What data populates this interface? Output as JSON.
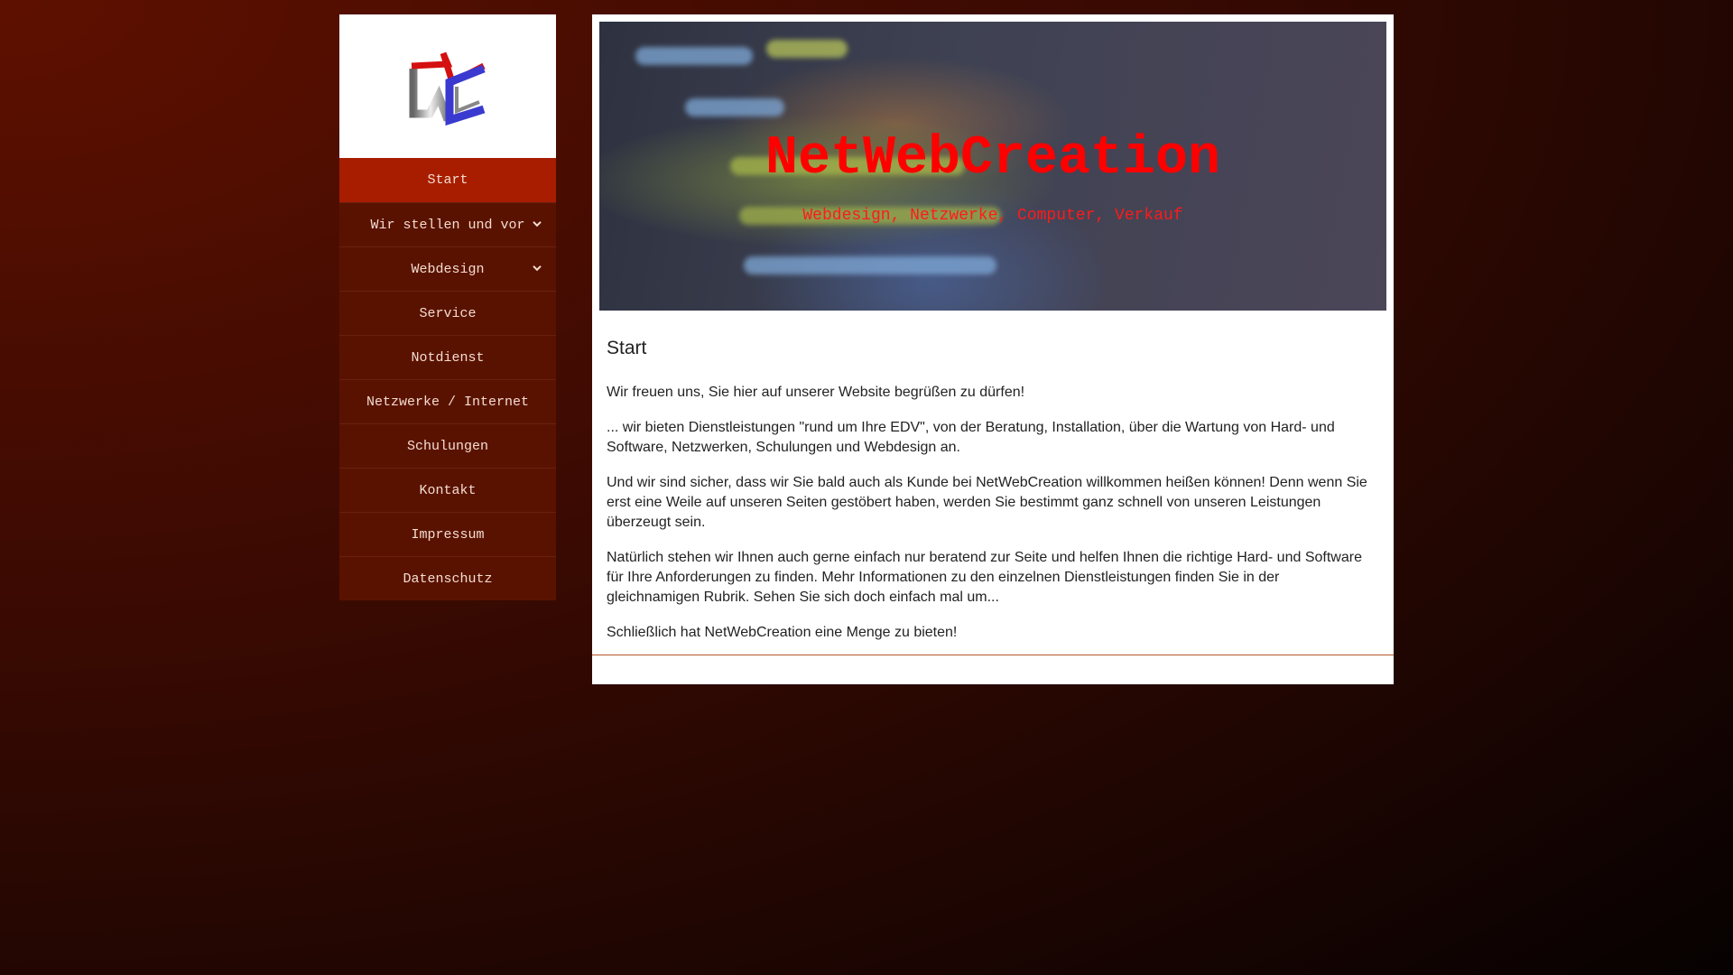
{
  "logo": {
    "alt": "NWC"
  },
  "nav": {
    "items": [
      {
        "label": "Start",
        "active": true,
        "has_submenu": false
      },
      {
        "label": "Wir stellen und vor",
        "active": false,
        "has_submenu": true
      },
      {
        "label": "Webdesign",
        "active": false,
        "has_submenu": true
      },
      {
        "label": "Service",
        "active": false,
        "has_submenu": false
      },
      {
        "label": "Notdienst",
        "active": false,
        "has_submenu": false
      },
      {
        "label": "Netzwerke / Internet",
        "active": false,
        "has_submenu": false
      },
      {
        "label": "Schulungen",
        "active": false,
        "has_submenu": false
      },
      {
        "label": "Kontakt",
        "active": false,
        "has_submenu": false
      },
      {
        "label": "Impressum",
        "active": false,
        "has_submenu": false
      },
      {
        "label": "Datenschutz",
        "active": false,
        "has_submenu": false
      }
    ]
  },
  "banner": {
    "title": "NetWebCreation",
    "subtitle": "Webdesign, Netzwerke, Computer, Verkauf"
  },
  "main": {
    "heading": "Start",
    "paragraphs": [
      "Wir freuen uns, Sie hier auf unserer Website begrüßen zu dürfen!",
      "... wir bieten Dienstleistungen \"rund um Ihre EDV\", von der Beratung, Installation, über die Wartung von Hard- und Software, Netzwerken, Schulungen und Webdesign an.",
      "Und wir sind sicher, dass wir Sie bald auch als Kunde bei NetWebCreation willkommen heißen können! Denn wenn Sie erst eine Weile auf unseren Seiten gestöbert haben, werden Sie bestimmt ganz schnell von unseren Leistungen überzeugt sein.",
      "Natürlich stehen wir Ihnen auch gerne einfach nur beratend zur Seite und helfen Ihnen die richtige Hard- und Software für Ihre Anforderungen zu finden. Mehr Informationen zu den einzelnen Dienstleistungen finden Sie in der gleichnamigen Rubrik. Sehen Sie sich doch einfach mal um...",
      "Schließlich hat NetWebCreation eine Menge zu bieten!"
    ]
  },
  "colors": {
    "active_nav": "#a81d00",
    "nav": "#5a1200",
    "banner_title": "#ff0000",
    "divider": "#b5552a"
  }
}
